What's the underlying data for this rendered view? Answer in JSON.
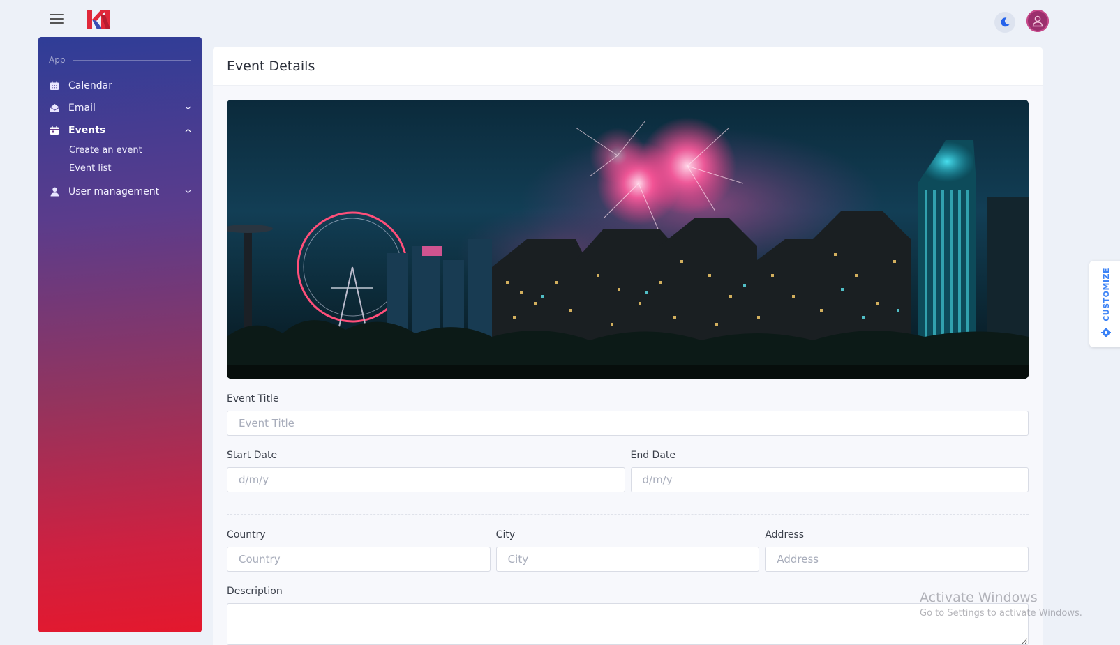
{
  "topbar": {
    "menu_icon": "hamburger-icon",
    "theme_icon": "moon-icon",
    "avatar_icon": "user-icon"
  },
  "sidebar": {
    "section": "App",
    "items": [
      {
        "label": "Calendar",
        "icon": "calendar-icon"
      },
      {
        "label": "Email",
        "icon": "mail-open-icon"
      },
      {
        "label": "Events",
        "icon": "calendar-event-icon"
      },
      {
        "label": "User management",
        "icon": "user-icon"
      }
    ],
    "event_subitems": [
      {
        "label": "Create an event"
      },
      {
        "label": "Event list"
      }
    ]
  },
  "main": {
    "title": "Event Details",
    "form": {
      "event_title_label": "Event Title",
      "event_title_placeholder": "Event Title",
      "start_date_label": "Start Date",
      "start_date_placeholder": "d/m/y",
      "end_date_label": "End Date",
      "end_date_placeholder": "d/m/y",
      "country_label": "Country",
      "country_placeholder": "Country",
      "city_label": "City",
      "city_placeholder": "City",
      "address_label": "Address",
      "address_placeholder": "Address",
      "description_label": "Description"
    }
  },
  "customize": {
    "label": "CUSTOMIZE",
    "icon": "gear-icon"
  },
  "watermark": {
    "line1": "Activate Windows",
    "line2": "Go to Settings to activate Windows."
  },
  "colors": {
    "accent": "#3b82f6",
    "sidebar_top": "#2f3d97",
    "sidebar_bottom": "#e4182d"
  }
}
